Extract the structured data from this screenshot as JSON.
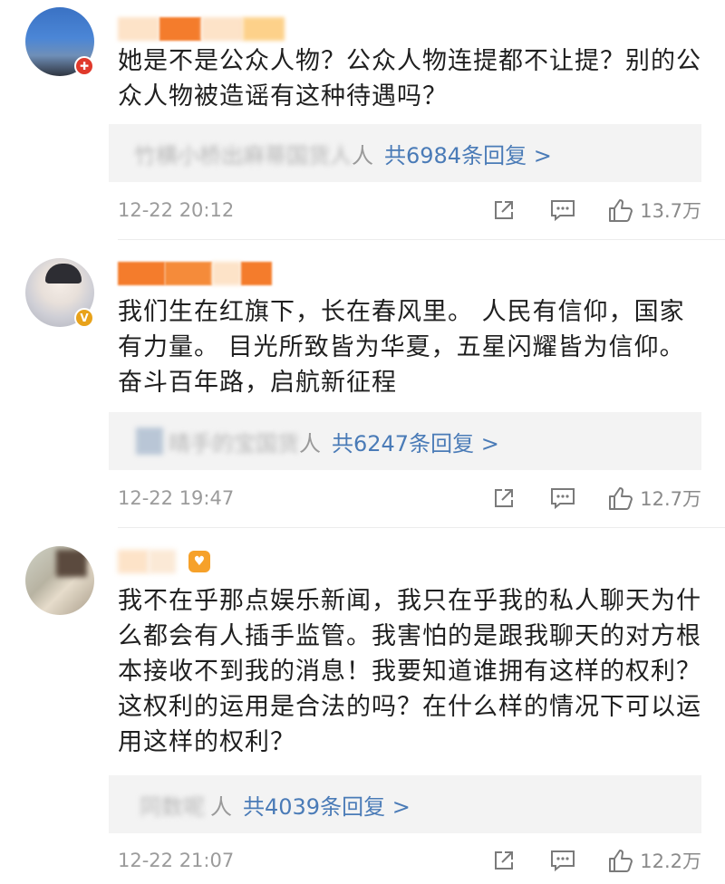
{
  "comments": [
    {
      "text": "她是不是公众人物？公众人物连提都不让提？别的公众人物被造谣有这种待遇吗？",
      "reply_preview": "竹横小桥出麻蒂国货人",
      "reply_link": "共6984条回复 >",
      "time": "12-22 20:12",
      "likes": "13.7万"
    },
    {
      "text": "我们生在红旗下，长在春风里。 人民有信仰，国家有力量。 目光所致皆为华夏，五星闪耀皆为信仰。奋斗百年路，启航新征程",
      "reply_preview": "晴手的宝国货",
      "reply_link": "共6247条回复 >",
      "time": "12-22 19:47",
      "likes": "12.7万"
    },
    {
      "text": "我不在乎那点娱乐新闻，我只在乎我的私人聊天为什么都会有人插手监管。我害怕的是跟我聊天的对方根本接收不到我的消息！我要知道谁拥有这样的权利？这权利的运用是合法的吗？在什么样的情况下可以运用这样的权利？",
      "reply_preview": "同数呢",
      "reply_link": "共4039条回复 >",
      "time": "12-22 21:07",
      "likes": "12.2万"
    }
  ],
  "icons": {
    "share": "share-icon",
    "comment": "comment-icon",
    "like": "thumbs-up-icon"
  },
  "colors": {
    "link": "#4a7bb7",
    "reply_bg": "#f3f3f3",
    "meta_text": "#9b9b9b",
    "vip_badge": "#e8a21a",
    "red_badge": "#e0392b"
  }
}
